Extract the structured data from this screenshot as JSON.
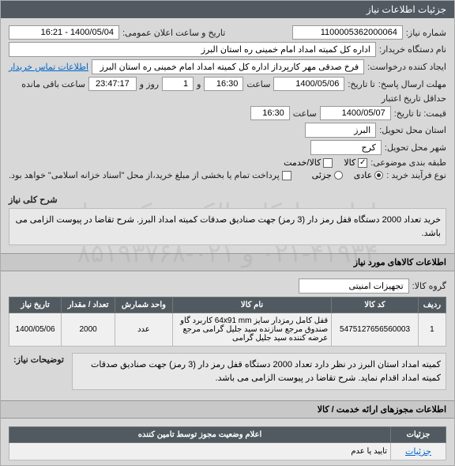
{
  "watermark": {
    "line1": "سامانه تدارکات\nالکترونیکی دولت",
    "line2": "۰۲۱-۴۱۹۳۴ و ۰۲۱-۸۵۱۹۳۷۶۸"
  },
  "header": {
    "title": "جزئیات اطلاعات نیاز"
  },
  "form": {
    "need_no_label": "شماره نیاز:",
    "need_no": "1100005362000064",
    "announce_label": "تاریخ و ساعت اعلان عمومی:",
    "announce_value": "1400/05/04 - 16:21",
    "buyer_label": "نام دستگاه خریدار:",
    "buyer_value": "اداره کل کمیته امداد امام خمینی ره استان البرز",
    "requester_label": "ایجاد کننده درخواست:",
    "requester_value": "فرخ صدقی مهر کارپرداز اداره کل کمیته امداد امام خمینی ره استان البرز",
    "contact_link": "اطلاعات تماس خریدار",
    "deadline_label": "مهلت ارسال پاسخ:",
    "until_label": "تا تاریخ:",
    "deadline_date": "1400/05/06",
    "time_label": "ساعت",
    "deadline_time": "16:30",
    "and_label": "و",
    "days_value": "1",
    "days_label": "روز و",
    "countdown": "23:47:17",
    "remaining_label": "ساعت باقی مانده",
    "validity_label": "حداقل تاریخ اعتبار",
    "price_until_label": "قیمت: تا تاریخ:",
    "validity_date": "1400/05/07",
    "validity_time": "16:30",
    "province_label": "استان محل تحویل:",
    "province_value": "البرز",
    "city_label": "شهر محل تحویل:",
    "city_value": "کرج",
    "category_label": "طبقه بندی موضوعی:",
    "cat_goods": "کالا",
    "cat_service": "کالا/خدمت",
    "process_label": "نوع فرآیند خرید :",
    "proc_full": "عادی",
    "proc_partial": "جزئی",
    "payment_note": "پرداخت تمام یا بخشی از مبلغ خرید،از محل \"اسناد خزانه اسلامی\" خواهد بود."
  },
  "desc": {
    "title": "شرح کلی نیاز",
    "text": "خرید تعداد 2000 دستگاه قفل رمز دار (3 رمز) جهت صنادیق صدقات کمیته امداد البرز. شرح تقاضا در پیوست الزامی می باشد."
  },
  "goods": {
    "title": "اطلاعات کالاهای مورد نیاز",
    "group_label": "گروه کالا:",
    "group_value": "تجهیزات امنیتی",
    "headers": {
      "row": "ردیف",
      "code": "کد کالا",
      "name": "نام کالا",
      "unit": "واحد شمارش",
      "qty": "تعداد / مقدار",
      "date": "تاریخ نیاز"
    },
    "rows": [
      {
        "row": "1",
        "code": "5475127656560003",
        "name": "قفل کامل رمزدار سایز 64x91 mm کاربرد گاو صندوق مرجع سازنده سید جلیل گرامی مرجع عرضه کننده سید جلیل گرامی",
        "unit": "عدد",
        "qty": "2000",
        "date": "1400/05/06"
      }
    ],
    "notes_label": "توضیحات نیاز:",
    "notes_text": "کمیته امداد استان البرز در نظر دارد تعداد 2000 دستگاه قفل رمز دار (3 رمز) جهت صنادیق صدقات کمیته امداد اقدام نماید. شرح تقاضا در پیوست الزامی می باشد."
  },
  "permits": {
    "title": "اطلاعات مجوزهای ارائه خدمت / کالا"
  },
  "status": {
    "title": "اعلام وضعیت مجوز توسط تامین کننده",
    "detail_link": "جزئیات",
    "accept_label": "تایید یا عدم"
  }
}
